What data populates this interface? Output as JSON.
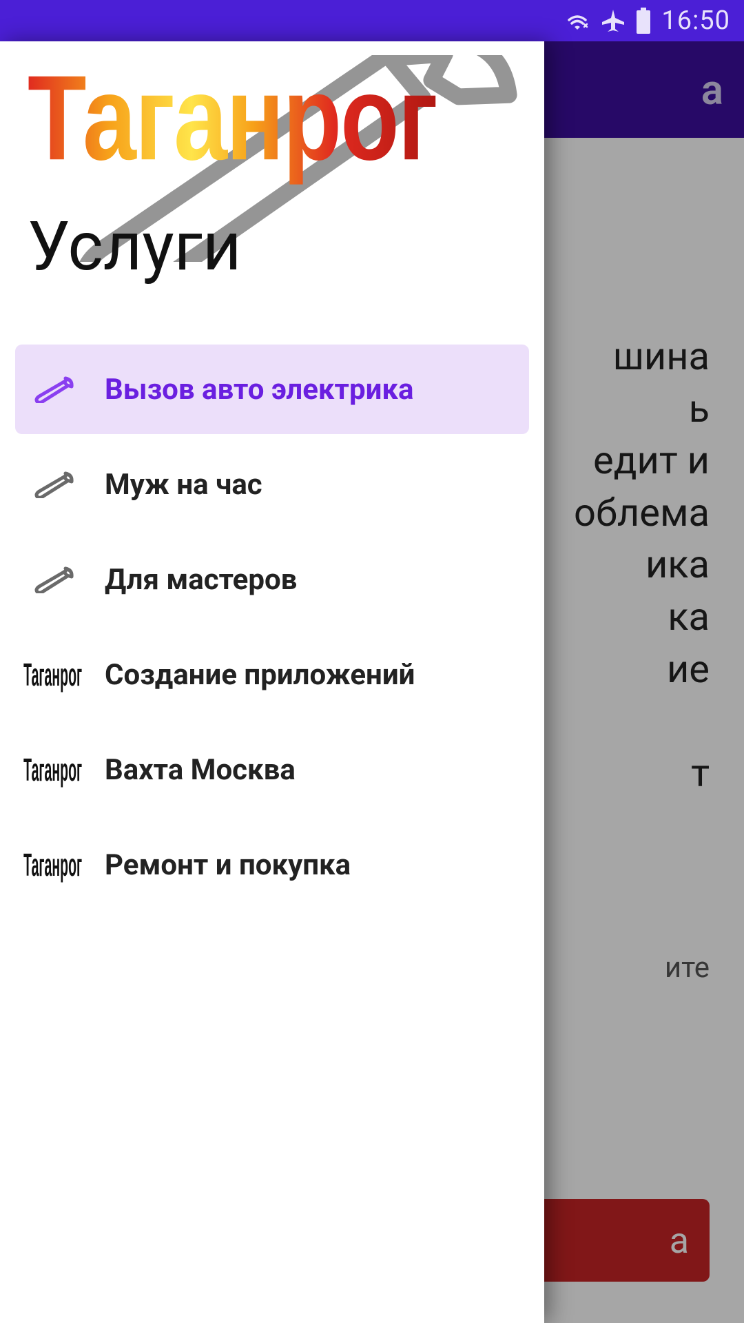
{
  "statusbar": {
    "time": "16:50"
  },
  "app_header": {
    "title_fragment": "а"
  },
  "behind": {
    "body_fragment": "шина\nь\nедит и\nоблема\nика\nка\nие\n\nт",
    "lower_fragment": "ите",
    "button_fragment": "а"
  },
  "drawer": {
    "logo_text": "Таганрог",
    "subtitle": "Услуги",
    "items": [
      {
        "label": "Вызов авто электрика",
        "icon": "wrench",
        "active": true
      },
      {
        "label": "Муж на час",
        "icon": "wrench",
        "active": false
      },
      {
        "label": "Для мастеров",
        "icon": "wrench",
        "active": false
      },
      {
        "label": "Создание приложений",
        "icon": "taganrog",
        "active": false
      },
      {
        "label": "Вахта Москва",
        "icon": "taganrog",
        "active": false
      },
      {
        "label": "Ремонт и покупка",
        "icon": "taganrog",
        "active": false
      }
    ]
  },
  "colors": {
    "statusbar_bg": "#4b1fd6",
    "header_bg": "#3c0f9e",
    "accent": "#6a1fe0",
    "active_bg": "#ecdffa",
    "red_button": "#c62425"
  }
}
